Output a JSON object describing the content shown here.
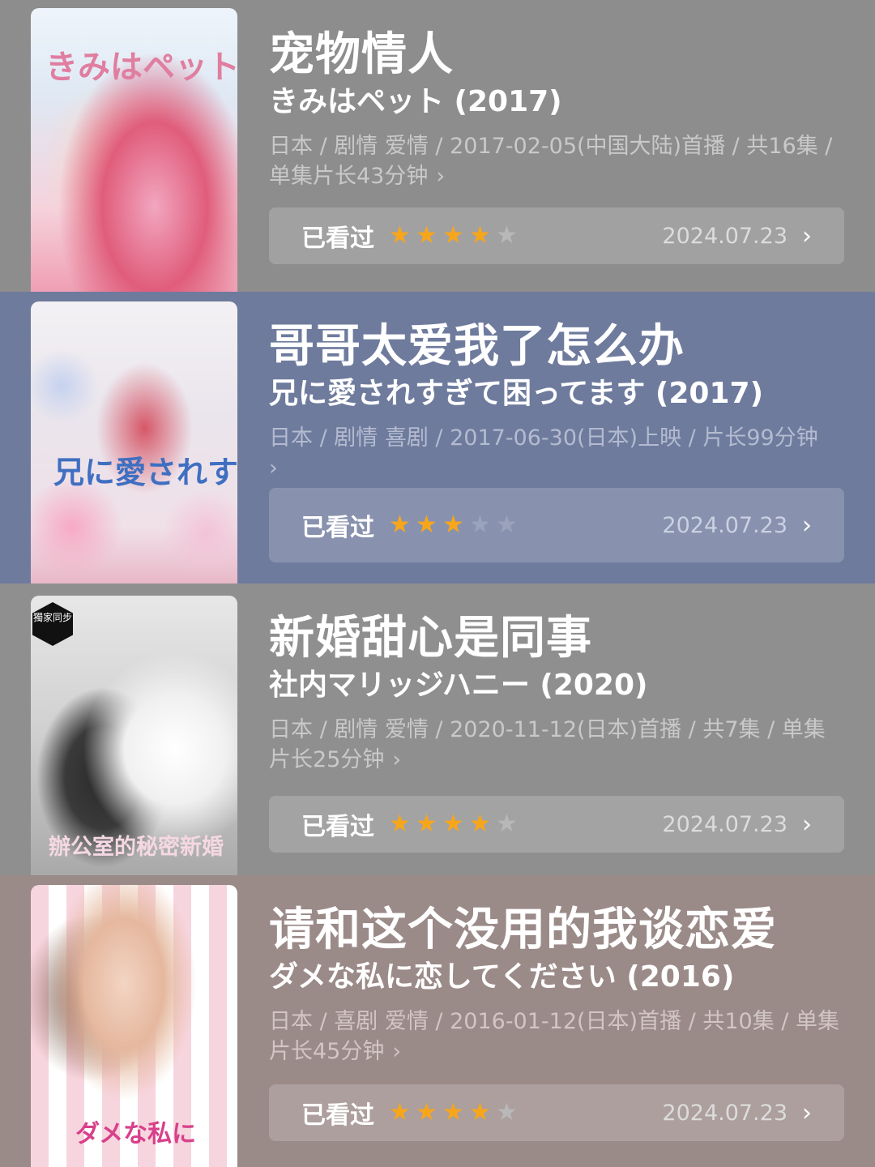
{
  "items": [
    {
      "title": "宠物情人",
      "subtitle": "きみはペット (2017)",
      "meta": "日本 / 剧情 爱情 / 2017-02-05(中国大陆)首播 / 共16集 / 单集片长43分钟",
      "watched_label": "已看过",
      "rating": 4,
      "date": "2024.07.23",
      "poster_text": "きみはペット"
    },
    {
      "title": "哥哥太爱我了怎么办",
      "subtitle": "兄に愛されすぎて困ってます (2017)",
      "meta": "日本 / 剧情 喜剧 / 2017-06-30(日本)上映 / 片长99分钟",
      "watched_label": "已看过",
      "rating": 3,
      "date": "2024.07.23",
      "poster_text": "兄に愛されすぎて"
    },
    {
      "title": "新婚甜心是同事",
      "subtitle": "社内マリッジハニー (2020)",
      "meta": "日本 / 剧情 爱情 / 2020-11-12(日本)首播 / 共7集 / 单集片长25分钟",
      "watched_label": "已看过",
      "rating": 4,
      "date": "2024.07.23",
      "poster_text": "辦公室的秘密新婚",
      "badge": "獨家同步"
    },
    {
      "title": "请和这个没用的我谈恋爱",
      "subtitle": "ダメな私に恋してください (2016)",
      "meta": "日本 / 喜剧 爱情 / 2016-01-12(日本)首播 / 共10集 / 单集片长45分钟",
      "watched_label": "已看过",
      "rating": 4,
      "date": "2024.07.23",
      "poster_text": "ダメな私に"
    }
  ],
  "max_rating": 5,
  "colors": {
    "star_on": "#f7a61c",
    "star_off": "#b8b8b8"
  },
  "icons": {
    "chevron": "chevron-right-icon",
    "star": "star-icon"
  }
}
